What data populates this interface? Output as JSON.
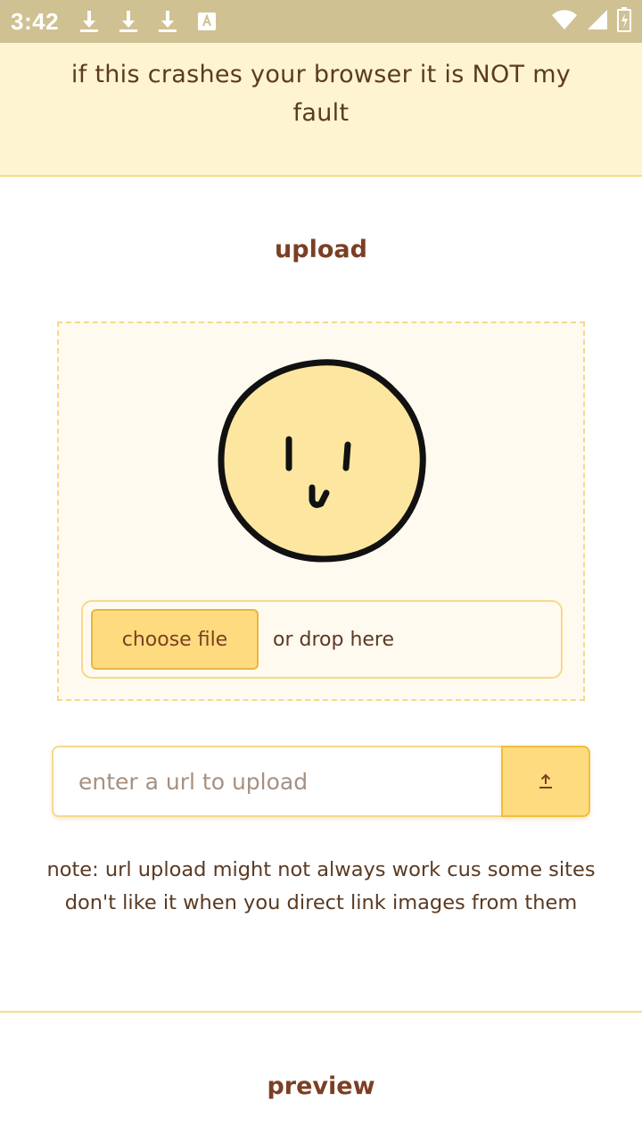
{
  "status_bar": {
    "time": "3:42",
    "left_icons": [
      "download-icon",
      "download-icon",
      "download-icon",
      "font-download-icon"
    ],
    "right_icons": [
      "wifi-icon",
      "signal-icon",
      "battery-icon"
    ]
  },
  "banner": {
    "text": "if this crashes your browser it is NOT my fault"
  },
  "upload": {
    "title": "upload",
    "choose_file_label": "choose file",
    "drop_label": "or drop here",
    "url_placeholder": "enter a url to upload",
    "submit_icon": "upload-arrow-icon",
    "note": "note: url upload might not always work cus some sites don't like it when you direct link images from them"
  },
  "preview": {
    "title": "preview"
  },
  "colors": {
    "status_bar": "#d0c193",
    "banner_bg": "#fff4d1",
    "accent": "#fddb7e",
    "accent_border": "#f5d98a",
    "title_text": "#7b3f24",
    "body_text": "#5a3a22",
    "face_fill": "#fde7a0"
  }
}
